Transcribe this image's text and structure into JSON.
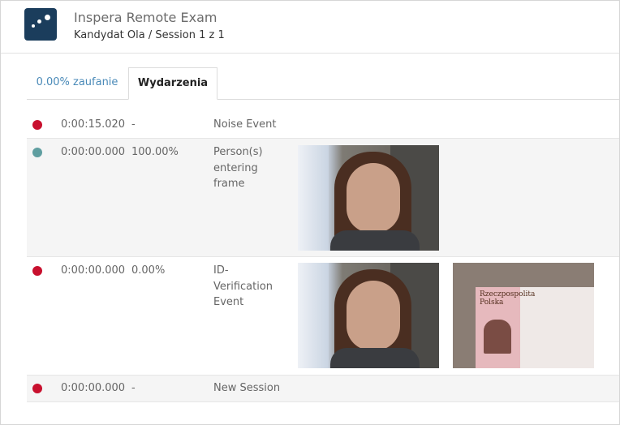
{
  "header": {
    "title": "Inspera Remote Exam",
    "subtitle": "Kandydat Ola / Session 1 z 1"
  },
  "tabs": [
    {
      "label": "0.00% zaufanie",
      "active": false
    },
    {
      "label": "Wydarzenia",
      "active": true
    }
  ],
  "colors": {
    "event_red": "#c8102e",
    "event_teal": "#5f9ea0",
    "accent": "#4a8ab8"
  },
  "events": [
    {
      "status": "red",
      "time": "0:00:15.020",
      "confidence": "-",
      "event": "Noise Event",
      "images": []
    },
    {
      "status": "teal",
      "time": "0:00:00.000",
      "confidence": "100.00%",
      "event": "Person(s) entering frame",
      "images": [
        "webcam-face"
      ]
    },
    {
      "status": "red",
      "time": "0:00:00.000",
      "confidence": "0.00%",
      "event": "ID-Verification Event",
      "images": [
        "webcam-face",
        "id-card"
      ]
    },
    {
      "status": "red",
      "time": "0:00:00.000",
      "confidence": "-",
      "event": "New Session",
      "images": []
    }
  ],
  "id_card_text": "Rzeczpospolita Polska"
}
